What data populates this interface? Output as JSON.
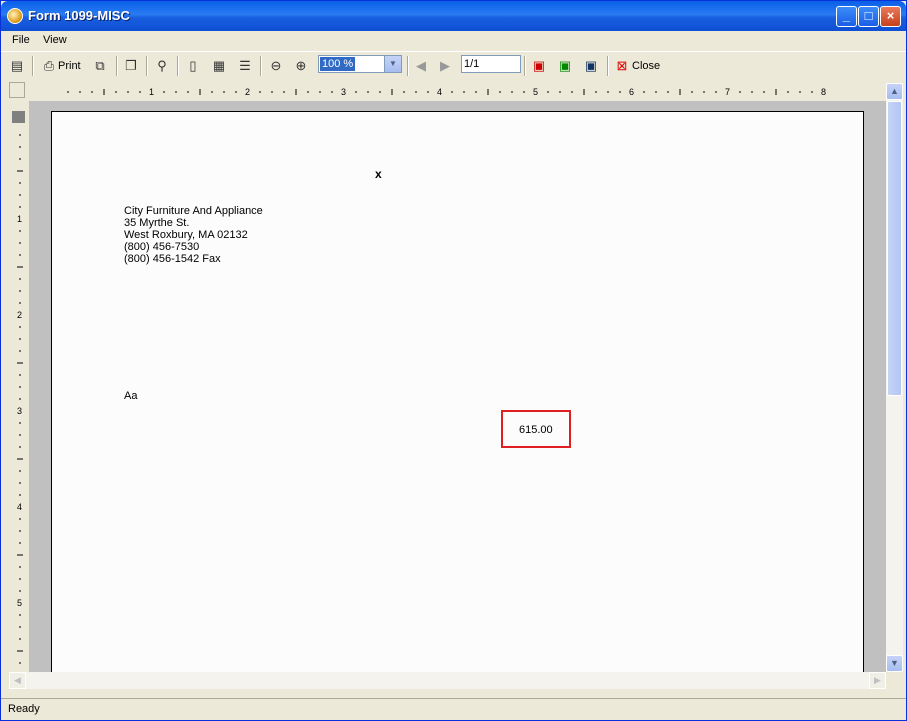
{
  "window": {
    "title": "Form 1099-MISC",
    "minimize": "_",
    "maximize": "□",
    "close": "×"
  },
  "menu": [
    "File",
    "View"
  ],
  "toolbar": {
    "print_label": "Print",
    "zoom_value": "100 %",
    "page_value": "1/1",
    "close_label": "Close"
  },
  "ruler": {
    "h_marks": [
      "1",
      "2",
      "3",
      "4",
      "5",
      "6",
      "7",
      "8"
    ],
    "v_marks": [
      "1",
      "2",
      "3",
      "4",
      "5"
    ]
  },
  "document": {
    "mark": "x",
    "company": {
      "name": "City Furniture And Appliance",
      "street": "35 Myrthe St.",
      "city": "West Roxbury,  MA  02132",
      "phone": "(800) 456-7530",
      "fax": "(800) 456-1542 Fax"
    },
    "recipient": "Aa",
    "amount": "615.00",
    "highlight_color": "#e02020"
  },
  "status": {
    "text": "Ready"
  }
}
